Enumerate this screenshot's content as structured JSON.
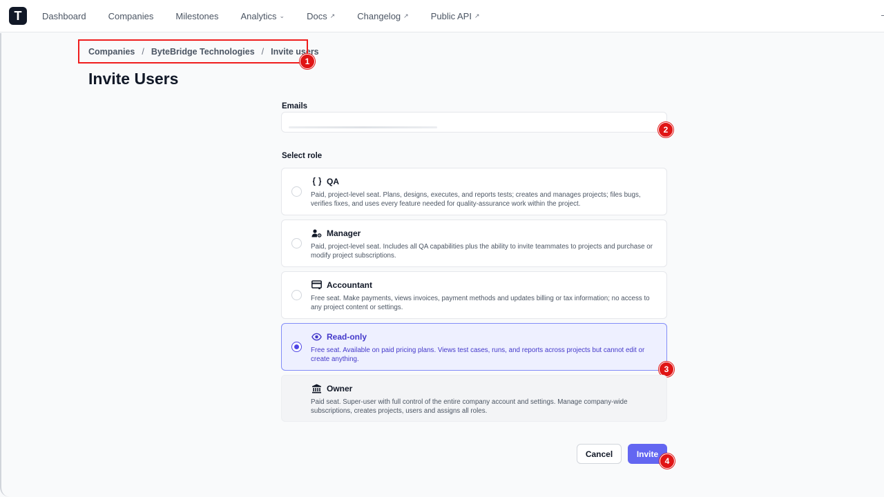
{
  "nav": {
    "logo_letter": "T",
    "items": [
      {
        "label": "Dashboard",
        "suffix": ""
      },
      {
        "label": "Companies",
        "suffix": ""
      },
      {
        "label": "Milestones",
        "suffix": ""
      },
      {
        "label": "Analytics",
        "suffix": "chevron-down"
      },
      {
        "label": "Docs",
        "suffix": "external-link"
      },
      {
        "label": "Changelog",
        "suffix": "external-link"
      },
      {
        "label": "Public API",
        "suffix": "external-link"
      }
    ]
  },
  "breadcrumb": {
    "items": [
      "Companies",
      "ByteBridge Technologies",
      "Invite users"
    ],
    "separator": "/"
  },
  "page_title": "Invite Users",
  "emails": {
    "label": "Emails",
    "value": ""
  },
  "roles": {
    "label": "Select role",
    "selected": "Read-only",
    "options": [
      {
        "icon": "code-braces-icon",
        "name": "QA",
        "description": "Paid, project-level seat. Plans, designs, executes, and reports tests; creates and manages projects; files bugs, verifies fixes, and uses every feature needed for quality-assurance work within the project."
      },
      {
        "icon": "user-gear-icon",
        "name": "Manager",
        "description": "Paid, project-level seat. Includes all QA capabilities plus the ability to invite teammates to projects and purchase or modify project subscriptions."
      },
      {
        "icon": "credit-card-icon",
        "name": "Accountant",
        "description": "Free seat. Make payments, views invoices, payment methods and updates billing or tax information; no access to any project content or settings."
      },
      {
        "icon": "eye-icon",
        "name": "Read-only",
        "description": "Free seat. Available on paid pricing plans. Views test cases, runs, and reports across projects but cannot edit or create anything."
      },
      {
        "icon": "bank-icon",
        "name": "Owner",
        "description": "Paid seat. Super-user with full control of the entire company account and settings. Manage company-wide subscriptions, creates projects, users and assigns all roles."
      }
    ]
  },
  "actions": {
    "cancel_label": "Cancel",
    "invite_label": "Invite"
  },
  "annotations": [
    "1",
    "2",
    "3",
    "4"
  ],
  "colors": {
    "primary": "#6366f1",
    "selected_bg": "#eef0ff",
    "annotation_red": "#e01515"
  }
}
